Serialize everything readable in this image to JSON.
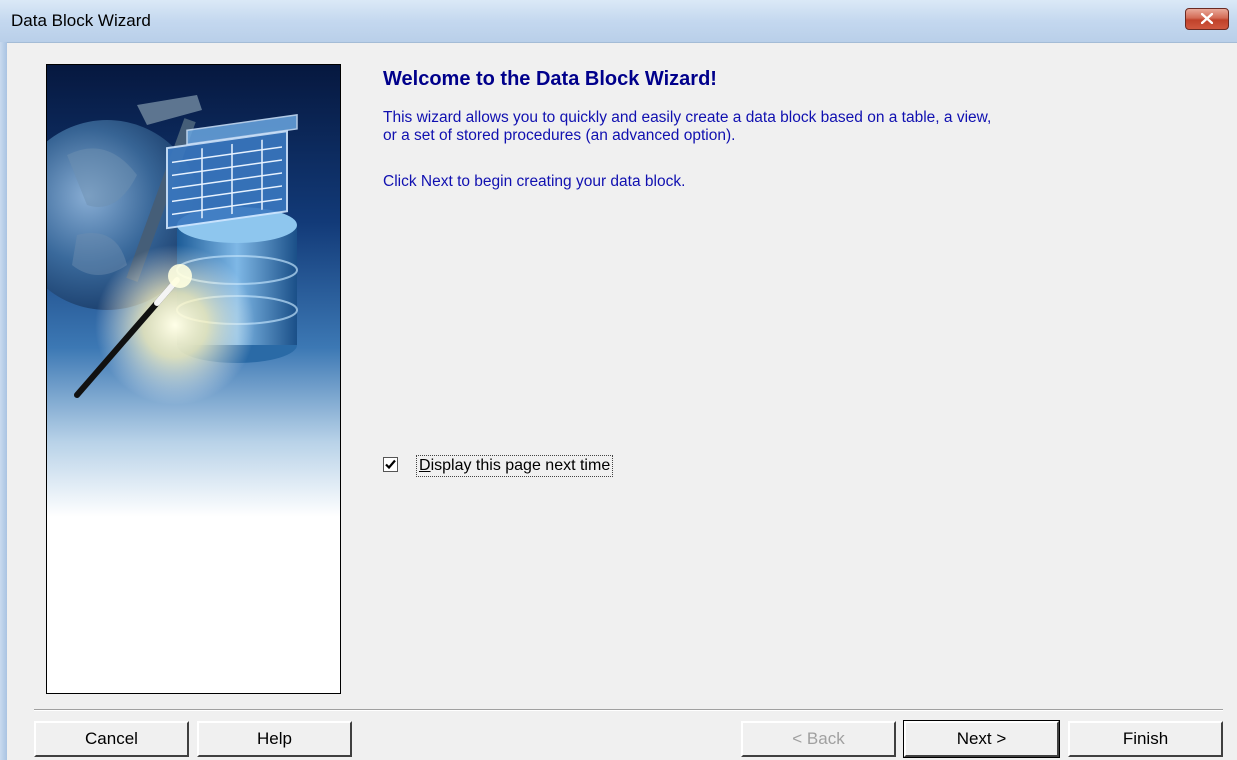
{
  "window": {
    "title": "Data Block Wizard"
  },
  "content": {
    "heading": "Welcome to the Data Block Wizard!",
    "description_line1": "This wizard allows you to quickly and easily create a data block based on a table, a view,",
    "description_line2": "or a set of stored procedures (an advanced option).",
    "hint": "Click Next to begin creating your data block."
  },
  "checkbox": {
    "label_first_letter": "D",
    "label_rest": "isplay this page next time",
    "checked": true
  },
  "buttons": {
    "cancel": "Cancel",
    "help": "Help",
    "back": "< Back",
    "next": "Next >",
    "finish": "Finish"
  },
  "colors": {
    "heading": "#00008b",
    "body_text": "#1010b0",
    "close_button": "#c0422b"
  },
  "icons": {
    "close": "close-x-icon",
    "check": "checkmark-icon",
    "illustration": "wizard-illustration"
  }
}
